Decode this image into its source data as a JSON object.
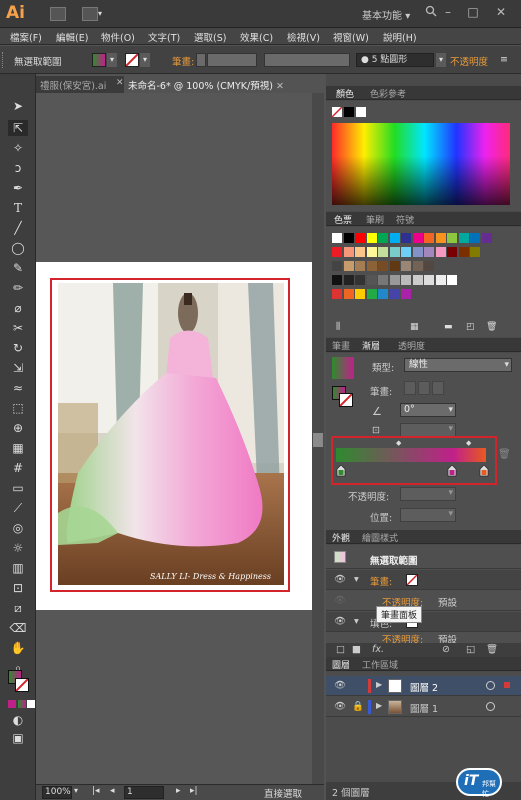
{
  "app": {
    "logo": "Ai",
    "workspace": "基本功能",
    "workspace_arrow": "▾"
  },
  "menu": [
    "檔案(F)",
    "編輯(E)",
    "物件(O)",
    "文字(T)",
    "選取(S)",
    "效果(C)",
    "檢視(V)",
    "視窗(W)",
    "說明(H)"
  ],
  "control": {
    "selection": "無選取範圍",
    "stroke_label": "筆畫:",
    "brush": "5 點圓形",
    "opacity_label": "不透明度",
    "opacity_icon": "≡"
  },
  "doc_tabs": [
    {
      "label": "禮服(保安宮).ai"
    },
    {
      "label": "未命名-6* @ 100% (CMYK/預視)"
    }
  ],
  "status": {
    "zoom": "100%",
    "artboard": "1",
    "tool": "直接選取"
  },
  "color_panel": {
    "tabs": [
      "顏色",
      "色彩參考"
    ]
  },
  "swatches_panel": {
    "tabs": [
      "色票",
      "筆刷",
      "符號"
    ]
  },
  "gradient_panel": {
    "tabs": [
      "筆畫",
      "漸層",
      "透明度"
    ],
    "type_label": "類型:",
    "type_value": "線性",
    "stroke_label": "筆畫:",
    "angle": "0°",
    "opacity_label": "不透明度:",
    "position_label": "位置:",
    "stops": [
      "#2e8b2e",
      "#c0208a",
      "#e85a20"
    ]
  },
  "appearance_panel": {
    "tabs": [
      "外觀",
      "繪圖樣式"
    ],
    "title": "無選取範圍",
    "stroke_label": "筆畫:",
    "opacity_label": "不透明度:",
    "opacity_value": "預設",
    "fill_label": "填色:",
    "fill_opacity_value": "預設",
    "tooltip": "筆畫面板",
    "fx": "fx."
  },
  "layers_panel": {
    "tabs": [
      "圖層",
      "工作區域"
    ],
    "layers": [
      {
        "name": "圖層 2",
        "color": "#d33a3a"
      },
      {
        "name": "圖層 1",
        "color": "#3a5ad3"
      }
    ],
    "count": "2 個圖層"
  },
  "watermark": {
    "text": "SALLY LI- Dress & Happiness"
  },
  "brand": {
    "main": "iT",
    "sub": "邦幫忙"
  }
}
